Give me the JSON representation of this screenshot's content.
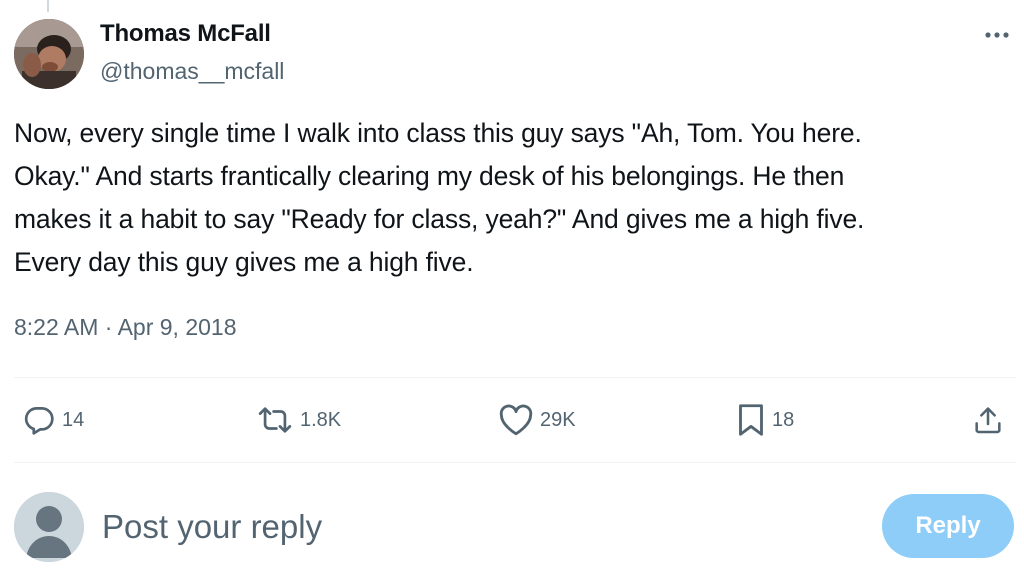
{
  "tweet": {
    "author_name": "Thomas McFall",
    "author_handle": "@thomas__mcfall",
    "text_lines": [
      "Now, every single time I walk into class this guy says \"Ah, Tom. You here.",
      "Okay.\" And starts frantically clearing my desk of his belongings. He then",
      "makes it a habit to say \"Ready for class, yeah?\" And gives me a high five.",
      "Every day this guy gives me a high five."
    ],
    "time": "8:22 AM",
    "date": "Apr 9, 2018",
    "separator": "·"
  },
  "actions": {
    "replies": "14",
    "reposts": "1.8K",
    "likes": "29K",
    "bookmarks": "18"
  },
  "reply_box": {
    "placeholder": "Post your reply",
    "button_label": "Reply"
  },
  "icons": {
    "more": "more-horizontal-icon",
    "reply": "reply-bubble-icon",
    "repost": "repost-icon",
    "like": "heart-icon",
    "bookmark": "bookmark-icon",
    "share": "share-icon"
  },
  "colors": {
    "text_primary": "#0f1419",
    "text_secondary": "#536471",
    "divider": "#eff3f4",
    "reply_button_disabled": "#8ecdf8"
  }
}
